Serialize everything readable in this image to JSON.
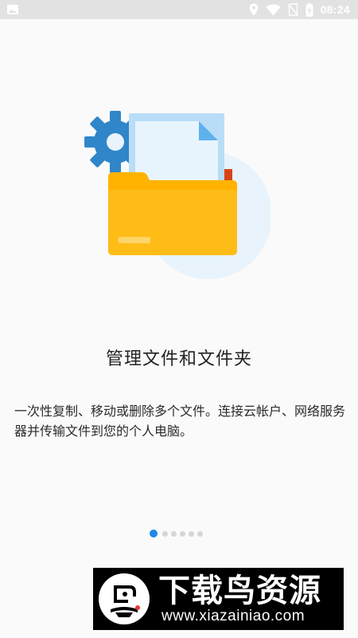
{
  "status_bar": {
    "time": "08:24",
    "icons": [
      "image-icon",
      "location-icon",
      "wifi-icon",
      "no-sim-icon",
      "battery-charging-icon"
    ]
  },
  "onboarding": {
    "illustration": "folder-with-documents-and-gear-icon",
    "title": "管理文件和文件夹",
    "description": "一次性复制、移动或删除多个文件。连接云帐户、网络服务器并传输文件到您的个人电脑。",
    "page_indicator": {
      "total": 6,
      "current": 1
    }
  },
  "watermark": {
    "title": "下载鸟资源",
    "url": "www.xiazainiao.com",
    "background": "#000000"
  },
  "colors": {
    "accent": "#1e88e5",
    "folder": "#ffb300",
    "gear": "#2f86c8"
  }
}
